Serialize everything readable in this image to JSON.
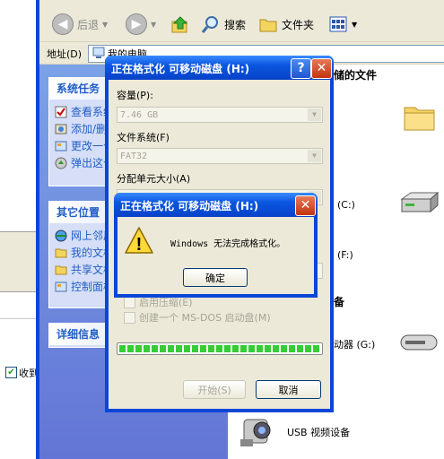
{
  "left_window": {
    "checkbox_label": "收到"
  },
  "toolbar": {
    "back_label": "后退",
    "search_label": "搜索",
    "folders_label": "文件夹"
  },
  "address": {
    "label": "地址(D)",
    "value": "我的电脑"
  },
  "task_pane": {
    "system_tasks": {
      "title": "系统任务",
      "items": [
        "查看系统信息",
        "添加/删除程序",
        "更改一个设置",
        "弹出这个磁盘"
      ]
    },
    "other_places": {
      "title": "其它位置",
      "items": [
        "网上邻居",
        "我的文档",
        "共享文档",
        "控制面板"
      ]
    },
    "details": {
      "title": "详细信息"
    }
  },
  "content": {
    "stored_files_header": "储的文件",
    "drive_c": "(C:)",
    "drive_f": "(F:)",
    "devices_header": "备",
    "drive_g": "动器 (G:)",
    "usb_video": "USB 视频设备"
  },
  "format_dialog": {
    "title": "正在格式化 可移动磁盘 (H:)",
    "help_button": "?",
    "close_button": "✕",
    "capacity_label": "容量(P):",
    "capacity_value": "7.46 GB",
    "filesystem_label": "文件系统(F)",
    "filesystem_value": "FAT32",
    "allocation_label": "分配单元大小(A)",
    "compress_label": "启用压缩(E)",
    "msdos_label": "创建一个 MS-DOS 启动盘(M)",
    "progress": 1.0,
    "start_button": "开始(S)",
    "cancel_button": "取消"
  },
  "alert_dialog": {
    "title": "正在格式化 可移动磁盘 (H:)",
    "close_button": "✕",
    "icon_glyph": "!",
    "message": "Windows 无法完成格式化。",
    "ok_button": "确定"
  },
  "colors": {
    "titlebar_blue": "#0a56e0",
    "dialog_face": "#ece9d8",
    "task_link": "#215dc6",
    "progress_green": "#35cc35"
  }
}
